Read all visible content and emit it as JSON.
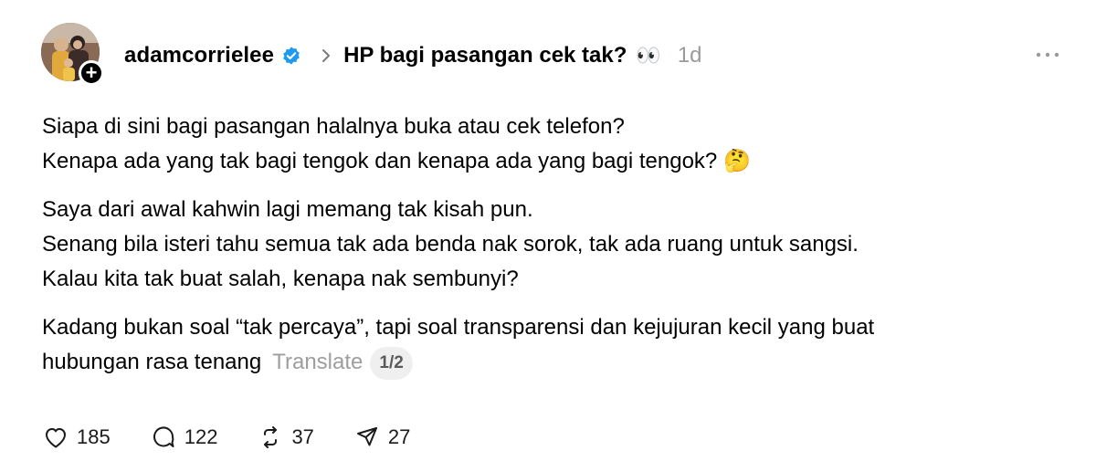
{
  "post": {
    "username": "adamcorrielee",
    "topic": "HP bagi pasangan cek tak?",
    "topic_emoji": "👀",
    "time": "1d",
    "more_icon": "more-horizontal-icon",
    "verified_icon": "verified-badge-icon",
    "follow_symbol": "+"
  },
  "content": {
    "p1_l1": "Siapa di sini bagi pasangan halalnya buka atau cek telefon?",
    "p1_l2": "Kenapa ada yang tak bagi tengok dan kenapa ada yang bagi tengok?",
    "p1_emoji": "🤔",
    "p2_l1": "Saya dari awal kahwin lagi memang tak kisah pun.",
    "p2_l2": "Senang bila isteri tahu semua tak ada benda nak sorok, tak ada ruang untuk sangsi.",
    "p2_l3": "Kalau kita tak buat salah, kenapa nak sembunyi?",
    "p3_l1": "Kadang bukan soal “tak percaya”, tapi soal transparensi dan kejujuran kecil yang buat",
    "p3_l2": "hubungan rasa tenang",
    "translate": "Translate",
    "page": "1/2"
  },
  "actions": {
    "likes": "185",
    "replies": "122",
    "reposts": "37",
    "shares": "27"
  },
  "colors": {
    "verified": "#1d9bf0",
    "muted": "#9a9a9a",
    "pill_bg": "#efefef"
  }
}
